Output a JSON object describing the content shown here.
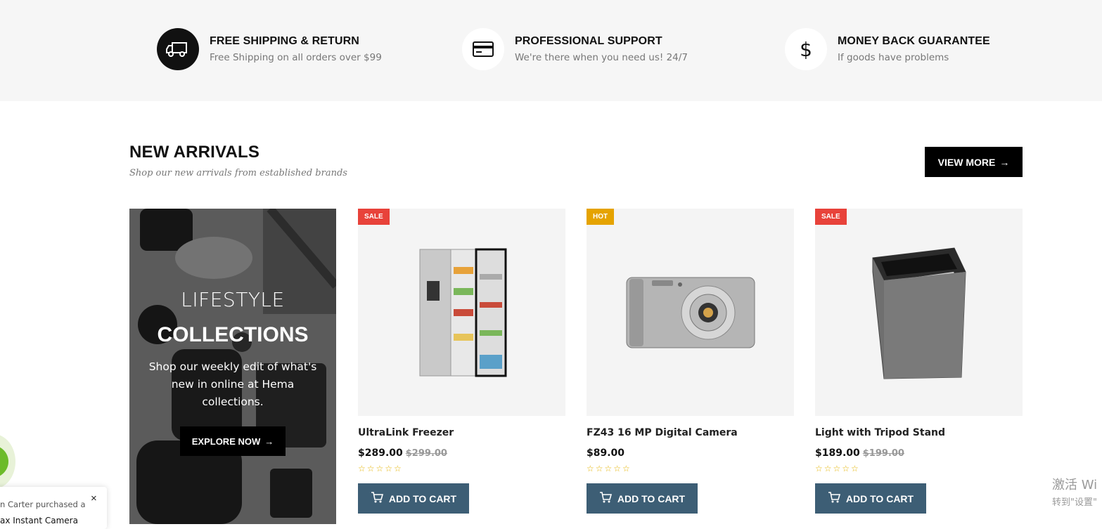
{
  "features": [
    {
      "icon": "truck-icon",
      "title": "FREE SHIPPING & RETURN",
      "subtitle": "Free Shipping on all orders over $99"
    },
    {
      "icon": "credit-card-icon",
      "title": "PROFESSIONAL SUPPORT",
      "subtitle": "We're there when you need us! 24/7"
    },
    {
      "icon": "dollar-icon",
      "title": "MONEY BACK GUARANTEE",
      "subtitle": "If goods have problems"
    }
  ],
  "section": {
    "title": "NEW ARRIVALS",
    "subtitle": "Shop our new arrivals from established brands",
    "view_more": "VIEW MORE"
  },
  "banner": {
    "line1": "LIFESTYLE",
    "line2": "COLLECTIONS",
    "description": "Shop our weekly edit of what's new in online at Hema collections.",
    "button": "EXPLORE NOW"
  },
  "products": [
    {
      "badge": "SALE",
      "badge_color": "#e8423a",
      "name": "UltraLink Freezer",
      "price": "$289.00",
      "old_price": "$299.00",
      "stars": "☆☆☆☆☆",
      "cta": "ADD TO CART"
    },
    {
      "badge": "HOT",
      "badge_color": "#e5a300",
      "name": "FZ43 16 MP Digital Camera",
      "price": "$89.00",
      "old_price": "",
      "stars": "☆☆☆☆☆",
      "cta": "ADD TO CART"
    },
    {
      "badge": "SALE",
      "badge_color": "#e8423a",
      "name": "Light with Tripod Stand",
      "price": "$189.00",
      "old_price": "$199.00",
      "stars": "☆☆☆☆☆",
      "cta": "ADD TO CART"
    }
  ],
  "popup": {
    "line1": "n Carter purchased a",
    "line2": "ax Instant Camera",
    "close": "×"
  },
  "watermark": {
    "line1": "激活 Wi",
    "line2": "转到\"设置\""
  }
}
